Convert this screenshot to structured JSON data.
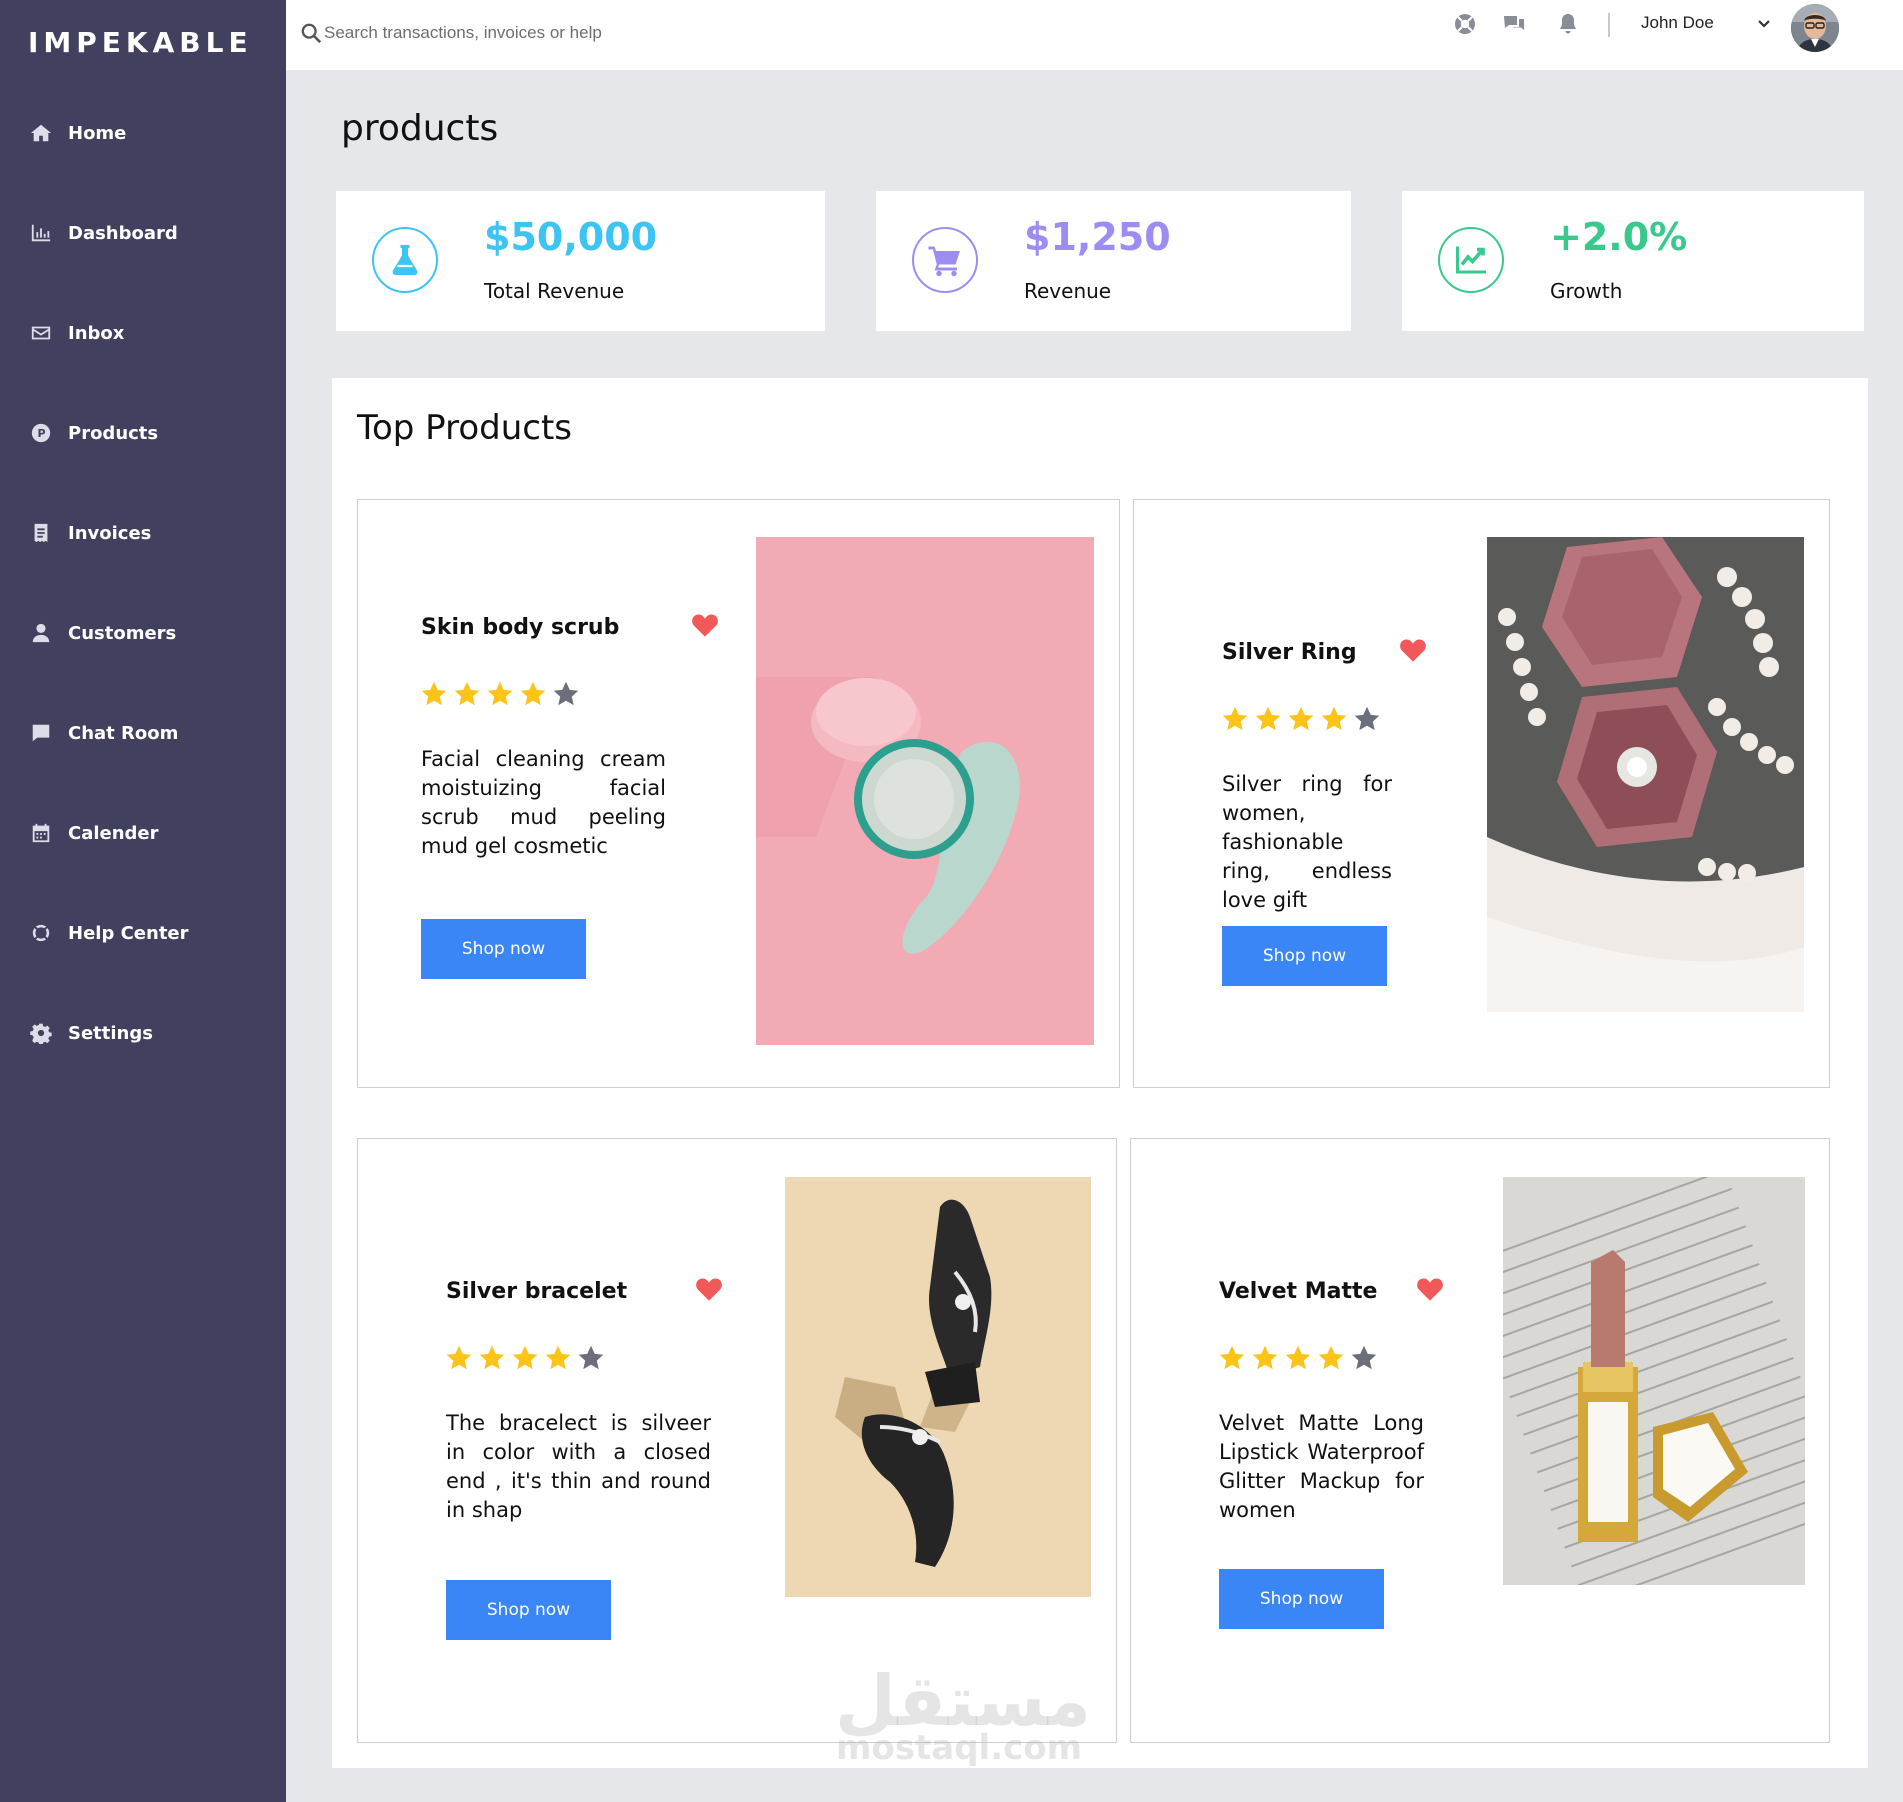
{
  "app": {
    "logo": "IMPEKABLE"
  },
  "sidebar": {
    "items": [
      {
        "label": "Home",
        "icon": "home-icon"
      },
      {
        "label": "Dashboard",
        "icon": "chart-bar-icon"
      },
      {
        "label": "Inbox",
        "icon": "envelope-icon"
      },
      {
        "label": "Products",
        "icon": "product-badge-icon"
      },
      {
        "label": "Invoices",
        "icon": "invoice-icon"
      },
      {
        "label": "Customers",
        "icon": "user-icon"
      },
      {
        "label": "Chat Room",
        "icon": "chat-bubble-icon"
      },
      {
        "label": "Calender",
        "icon": "calendar-icon"
      },
      {
        "label": "Help Center",
        "icon": "life-ring-icon"
      },
      {
        "label": "Settings",
        "icon": "gear-icon"
      }
    ]
  },
  "topbar": {
    "search_placeholder": "Search transactions, invoices or help",
    "user_name": "John Doe"
  },
  "page": {
    "title": "products"
  },
  "stats": [
    {
      "value": "$50,000",
      "label": "Total Revenue",
      "color": "#3cc4f2",
      "icon": "flask-icon"
    },
    {
      "value": "$1,250",
      "label": "Revenue",
      "color": "#9f8cf3",
      "icon": "shopping-cart-icon"
    },
    {
      "value": "+2.0%",
      "label": "Growth",
      "color": "#3ac98c",
      "icon": "trend-up-icon"
    }
  ],
  "top_products": {
    "title": "Top Products",
    "items": [
      {
        "name": "Skin body scrub",
        "rating": 4,
        "description": "Facial cleaning cream moistuizing facial scrub mud peeling mud gel cosmetic",
        "button": "Shop now"
      },
      {
        "name": "Silver Ring",
        "rating": 4,
        "description": "Silver ring for women, fashionable ring, endless love gift",
        "button": "Shop now"
      },
      {
        "name": "Silver bracelet",
        "rating": 4,
        "description": "The bracelect is silveer in color with a closed end , it's thin and round in shap",
        "button": "Shop now"
      },
      {
        "name": "Velvet Matte",
        "rating": 4,
        "description": "Velvet Matte Long Lipstick Waterproof Glitter Mackup for women",
        "button": "Shop now"
      }
    ]
  },
  "colors": {
    "sidebar_bg": "#41405e",
    "button": "#3a86f7",
    "star_filled": "#fcc419",
    "star_empty": "#6c6f7a",
    "heart": "#f0585a"
  },
  "watermark": {
    "arabic": "مستقل",
    "latin": "mostaql.com"
  }
}
